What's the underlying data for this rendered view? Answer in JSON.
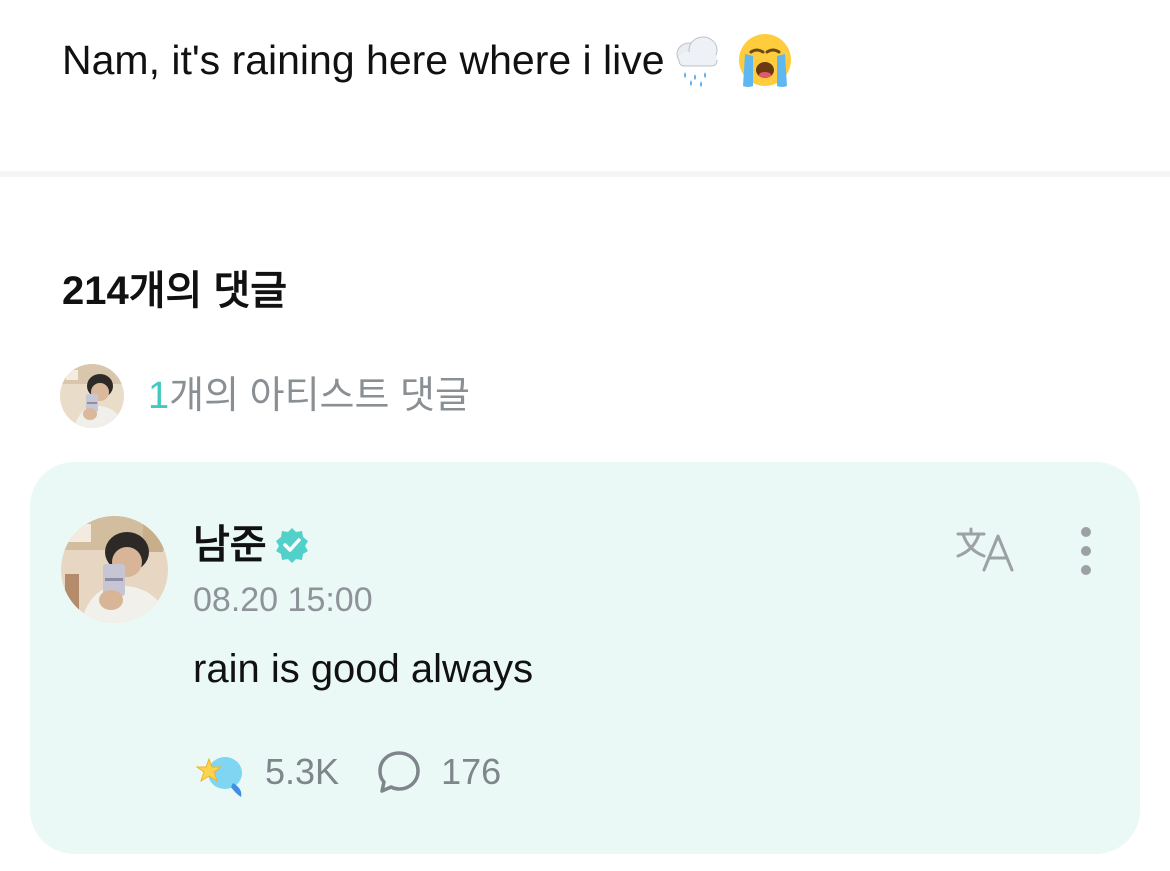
{
  "post": {
    "text": "Nam, it's raining here where i live",
    "emojis": [
      "cloud-with-rain-icon",
      "loudly-crying-face-icon"
    ]
  },
  "comments_section": {
    "heading": "214개의 댓글",
    "artist_summary": {
      "count": "1",
      "label": "개의 아티스트 댓글"
    }
  },
  "artist_comment": {
    "author": "남준",
    "verified": true,
    "timestamp": "08.20 15:00",
    "body": "rain is good always",
    "reactions": "5.3K",
    "replies": "176",
    "icons": {
      "translate": "translate-icon",
      "more": "more-vertical-icon",
      "reaction": "star-reaction-icon",
      "reply": "speech-bubble-icon"
    }
  },
  "colors": {
    "accent": "#3fc9c2",
    "card_background": "#ebf9f6",
    "muted_text": "#8a8f94"
  }
}
